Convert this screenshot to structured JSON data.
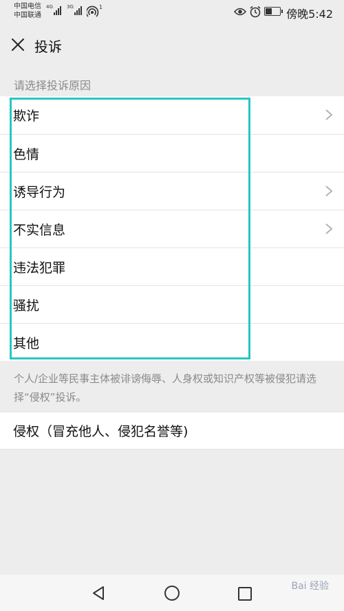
{
  "status_bar": {
    "carrier1": "中国电信",
    "carrier2": "中国联通",
    "net1": "4G",
    "net2": "3G",
    "hotspot_count": "1",
    "time": "傍晚5:42"
  },
  "header": {
    "title": "投诉"
  },
  "section_label": "请选择投诉原因",
  "reasons": [
    {
      "label": "欺诈",
      "has_arrow": true
    },
    {
      "label": "色情",
      "has_arrow": false
    },
    {
      "label": "诱导行为",
      "has_arrow": true
    },
    {
      "label": "不实信息",
      "has_arrow": true
    },
    {
      "label": "违法犯罪",
      "has_arrow": false
    },
    {
      "label": "骚扰",
      "has_arrow": false
    },
    {
      "label": "其他",
      "has_arrow": false
    }
  ],
  "note": "个人/企业等民事主体被诽谤侮辱、人身权或知识产权等被侵犯请选择“侵权”投诉。",
  "infringement": {
    "label": "侵权（冒充他人、侵犯名誉等)"
  },
  "watermark": "Bai 经验",
  "colors": {
    "highlight": "#25c7c4",
    "background": "#ededed"
  }
}
